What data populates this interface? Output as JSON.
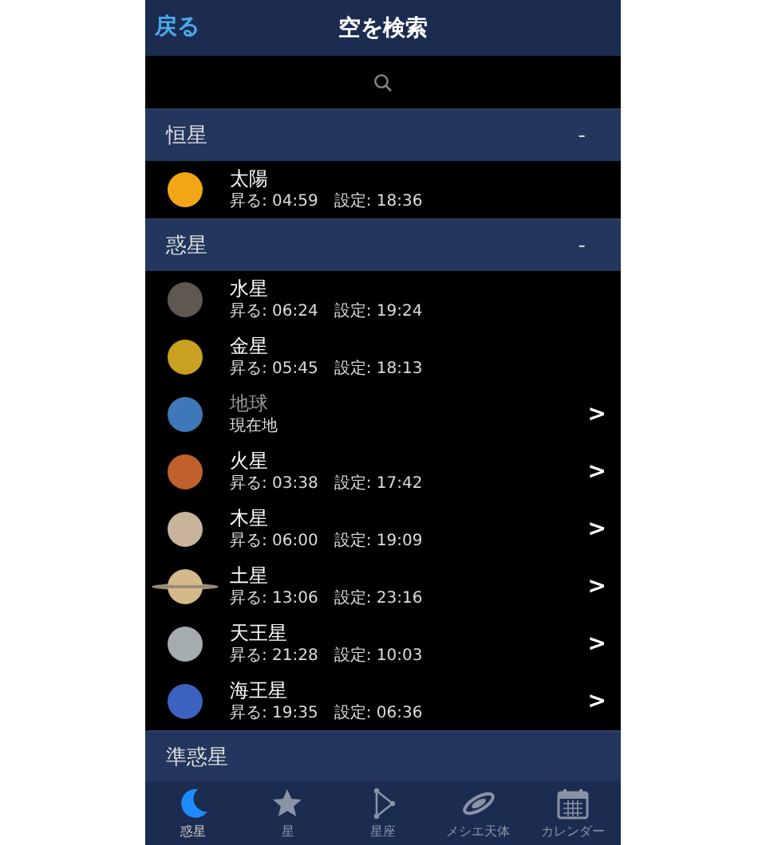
{
  "nav_bar": {
    "back": "戻る",
    "title": "空を検索"
  },
  "sections": [
    {
      "title": "恒星",
      "toggle": "-",
      "items": [
        {
          "name": "太陽",
          "detail": "昇る: 04:59　設定: 18:36",
          "color": "#f2a516",
          "kind": "plain",
          "current": false
        }
      ]
    },
    {
      "title": "惑星",
      "toggle": "-",
      "items": [
        {
          "name": "水星",
          "detail": "昇る: 06:24　設定: 19:24",
          "color": "#5e5850",
          "kind": "plain",
          "current": false
        },
        {
          "name": "金星",
          "detail": "昇る: 05:45　設定: 18:13",
          "color": "#c9a020",
          "kind": "plain",
          "current": false
        },
        {
          "name": "地球",
          "detail": "現在地",
          "color": "#3f78b8",
          "kind": "plain",
          "current": true,
          "chevron": ">"
        },
        {
          "name": "火星",
          "detail": "昇る: 03:38　設定: 17:42",
          "color": "#c0602c",
          "kind": "plain",
          "current": false,
          "chevron": ">"
        },
        {
          "name": "木星",
          "detail": "昇る: 06:00　設定: 19:09",
          "color": "#c8b49a",
          "kind": "plain",
          "current": false,
          "chevron": ">"
        },
        {
          "name": "土星",
          "detail": "昇る: 13:06　設定: 23:16",
          "color": "#d4b98a",
          "kind": "ringed",
          "current": false,
          "chevron": ">"
        },
        {
          "name": "天王星",
          "detail": "昇る: 21:28　設定: 10:03",
          "color": "#a4acb0",
          "kind": "plain",
          "current": false,
          "chevron": ">"
        },
        {
          "name": "海王星",
          "detail": "昇る: 19:35　設定: 06:36",
          "color": "#3c62c0",
          "kind": "plain",
          "current": false,
          "chevron": ">"
        }
      ]
    },
    {
      "title": "準惑星"
    }
  ],
  "tab_bar": [
    {
      "label": "惑星",
      "selected": true
    },
    {
      "label": "星",
      "selected": false
    },
    {
      "label": "星座",
      "selected": false
    },
    {
      "label": "メシエ天体",
      "selected": false
    },
    {
      "label": "カレンダー",
      "selected": false
    }
  ]
}
